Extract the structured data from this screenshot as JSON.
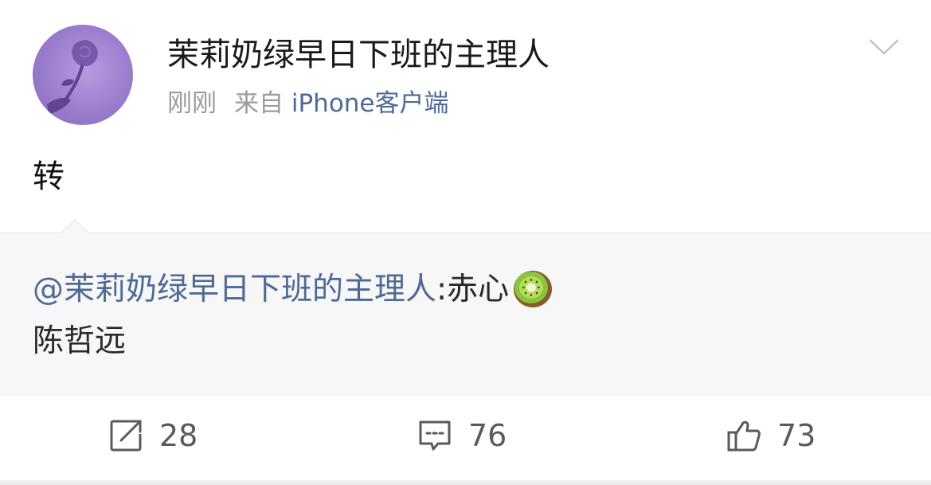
{
  "post": {
    "username": "茉莉奶绿早日下班的主理人",
    "time": "刚刚",
    "source_prefix": "来自",
    "source_app": "iPhone客户端",
    "text": "转",
    "icons": {
      "avatar": "rose-silhouette-avatar",
      "menu": "chevron-down-icon"
    }
  },
  "quote": {
    "mention": "@茉莉奶绿早日下班的主理人",
    "text": ":赤心",
    "emoji": "kiwi-emoji",
    "line2": "陈哲远"
  },
  "actions": {
    "repost": {
      "icon": "repost-icon",
      "count": "28"
    },
    "comment": {
      "icon": "comment-icon",
      "count": "76"
    },
    "like": {
      "icon": "thumbs-up-icon",
      "count": "73"
    }
  },
  "colors": {
    "link": "#4d6a96",
    "meta": "#9b9b9b",
    "quote_bg": "#f7f7f7",
    "avatar_bg": "#9a7ccd"
  }
}
